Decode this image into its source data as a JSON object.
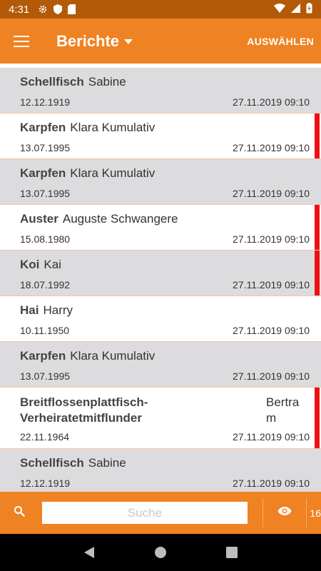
{
  "status_bar": {
    "time": "4:31"
  },
  "app_bar": {
    "title": "Berichte",
    "select_label": "AUSWÄHLEN"
  },
  "colors": {
    "primary": "#ef8222",
    "status": "#b25a07",
    "flag": "#ee1111",
    "row_alt": "#dcdcde"
  },
  "reports": [
    {
      "surname": "Schellfisch",
      "given": "Sabine",
      "dob": "12.12.1919",
      "timestamp": "27.11.2019 09:10",
      "flagged": false
    },
    {
      "surname": "Karpfen",
      "given": "Klara Kumulativ",
      "dob": "13.07.1995",
      "timestamp": "27.11.2019 09:10",
      "flagged": true
    },
    {
      "surname": "Karpfen",
      "given": "Klara Kumulativ",
      "dob": "13.07.1995",
      "timestamp": "27.11.2019 09:10",
      "flagged": false
    },
    {
      "surname": "Auster",
      "given": "Auguste Schwangere",
      "dob": "15.08.1980",
      "timestamp": "27.11.2019 09:10",
      "flagged": true
    },
    {
      "surname": "Koi",
      "given": "Kai",
      "dob": "18.07.1992",
      "timestamp": "27.11.2019 09:10",
      "flagged": true
    },
    {
      "surname": "Hai",
      "given": "Harry",
      "dob": "10.11.1950",
      "timestamp": "27.11.2019 09:10",
      "flagged": false
    },
    {
      "surname": "Karpfen",
      "given": "Klara Kumulativ",
      "dob": "13.07.1995",
      "timestamp": "27.11.2019 09:10",
      "flagged": false
    },
    {
      "surname": "Breitflossenplattfisch-Verheiratetmitflunder",
      "given": "Bertram",
      "dob": "22.11.1964",
      "timestamp": "27.11.2019 09:10",
      "flagged": true
    },
    {
      "surname": "Schellfisch",
      "given": "Sabine",
      "dob": "12.12.1919",
      "timestamp": "27.11.2019 09:10",
      "flagged": false
    }
  ],
  "bottom_bar": {
    "search_placeholder": "Suche",
    "search_value": "",
    "count": "16"
  },
  "icons": {
    "menu": "menu-icon",
    "dropdown": "chevron-down-icon",
    "search": "search-icon",
    "eye": "eye-icon",
    "back": "back-icon",
    "home": "home-icon",
    "recents": "recents-icon"
  }
}
